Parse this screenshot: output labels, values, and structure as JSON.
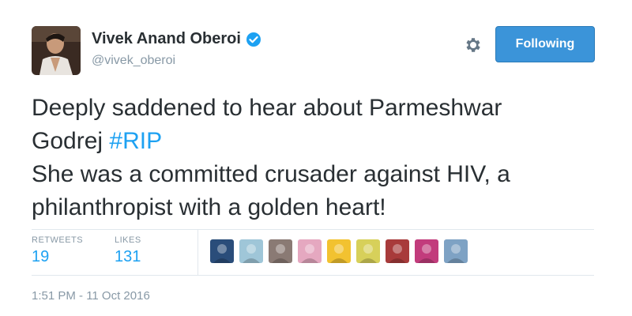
{
  "user": {
    "display_name": "Vivek Anand Oberoi",
    "handle": "@vivek_oberoi",
    "verified_color": "#1da1f2"
  },
  "actions": {
    "follow_label": "Following",
    "follow_color": "#3b94d9",
    "settings_icon": "gear-icon"
  },
  "tweet": {
    "line1": "Deeply saddened to hear about Parmeshwar",
    "line2_prefix": "Godrej ",
    "hashtag": "#RIP",
    "line3": "She was a committed crusader against HIV, a",
    "line4": "philanthropist with a golden heart!",
    "hashtag_color": "#1da1f2"
  },
  "stats": {
    "retweets_label": "RETWEETS",
    "retweets_count": "19",
    "likes_label": "LIKES",
    "likes_count": "131"
  },
  "likers": [
    {
      "name": "liker-avatar-1",
      "color": "#2a4d7a"
    },
    {
      "name": "liker-avatar-2",
      "color": "#9fc6d8"
    },
    {
      "name": "liker-avatar-3",
      "color": "#8a7a74"
    },
    {
      "name": "liker-avatar-4",
      "color": "#e5a8c0"
    },
    {
      "name": "liker-avatar-5",
      "color": "#f2c230"
    },
    {
      "name": "liker-avatar-6",
      "color": "#d7d05a"
    },
    {
      "name": "liker-avatar-7",
      "color": "#a83b3b"
    },
    {
      "name": "liker-avatar-8",
      "color": "#c23c7c"
    },
    {
      "name": "liker-avatar-9",
      "color": "#7ea2c4"
    }
  ],
  "timestamp": "1:51 PM - 11 Oct 2016"
}
